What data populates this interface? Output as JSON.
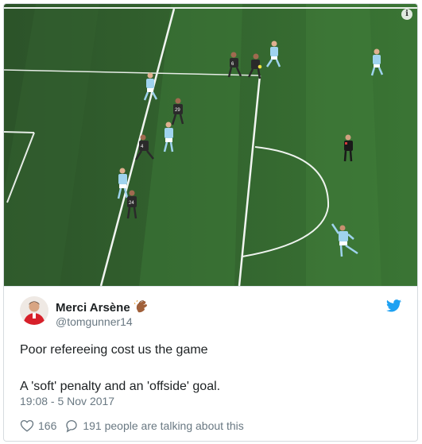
{
  "tweet": {
    "media": {
      "alt_icon": "info-icon",
      "info_glyph": "i"
    },
    "author": {
      "name": "Merci Arsène",
      "handle": "@tomgunner14",
      "avatar_icon": "avatar",
      "name_emoji": "clapping-hands-icon"
    },
    "brand_icon": "twitter-bird-icon",
    "text_lines": [
      "Poor refereeing cost us the game",
      "A 'soft' penalty and an 'offside' goal."
    ],
    "timestamp": "19:08 - 5 Nov 2017",
    "likes": "166",
    "replies_text": "191 people are talking about this"
  },
  "colors": {
    "pitch_dark": "#2f5a2c",
    "pitch_light": "#3c7a38",
    "twitter_blue": "#1da1f2",
    "secondary_text": "#697882",
    "city_kit": "#9fd3ee",
    "opponent_kit": "#2a2a2a",
    "referee_kit": "#1a1a1a"
  }
}
